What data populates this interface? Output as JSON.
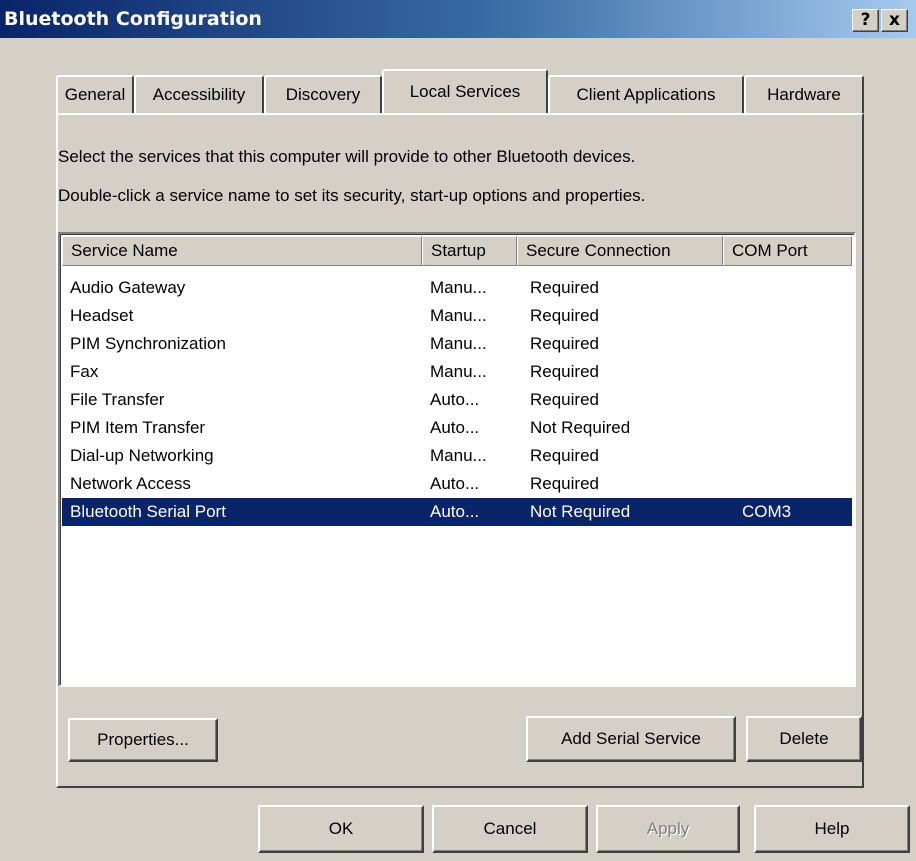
{
  "window": {
    "title": "Bluetooth Configuration",
    "help_label": "?",
    "close_label": "x"
  },
  "tabs": [
    {
      "label": "General"
    },
    {
      "label": "Accessibility"
    },
    {
      "label": "Discovery"
    },
    {
      "label": "Local Services"
    },
    {
      "label": "Client Applications"
    },
    {
      "label": "Hardware"
    }
  ],
  "active_tab": "Local Services",
  "panel": {
    "instruction_1": "Select the services that this computer will provide to other Bluetooth devices.",
    "instruction_2": "Double-click a service name to set its security, start-up options and properties."
  },
  "table": {
    "columns": [
      "Service Name",
      "Startup",
      "Secure Connection",
      "COM Port"
    ],
    "rows": [
      {
        "name": "Audio Gateway",
        "startup": "Manu...",
        "secure": "Required",
        "com": ""
      },
      {
        "name": "Headset",
        "startup": "Manu...",
        "secure": "Required",
        "com": ""
      },
      {
        "name": "PIM Synchronization",
        "startup": "Manu...",
        "secure": "Required",
        "com": ""
      },
      {
        "name": "Fax",
        "startup": "Manu...",
        "secure": "Required",
        "com": ""
      },
      {
        "name": "File Transfer",
        "startup": "Auto...",
        "secure": "Required",
        "com": ""
      },
      {
        "name": "PIM Item Transfer",
        "startup": "Auto...",
        "secure": "Not Required",
        "com": ""
      },
      {
        "name": "Dial-up Networking",
        "startup": "Manu...",
        "secure": "Required",
        "com": ""
      },
      {
        "name": "Network Access",
        "startup": "Auto...",
        "secure": "Required",
        "com": ""
      },
      {
        "name": "Bluetooth Serial Port",
        "startup": "Auto...",
        "secure": "Not Required",
        "com": "COM3"
      }
    ],
    "selected_row": "Bluetooth Serial Port"
  },
  "panel_buttons": {
    "properties": "Properties...",
    "add_serial": "Add Serial Service",
    "delete": "Delete"
  },
  "dialog_buttons": {
    "ok": "OK",
    "cancel": "Cancel",
    "apply": "Apply",
    "help": "Help"
  },
  "colors": {
    "title_bar": "#0a246a",
    "selection": "#0a246a",
    "face": "#d4d0c8"
  }
}
